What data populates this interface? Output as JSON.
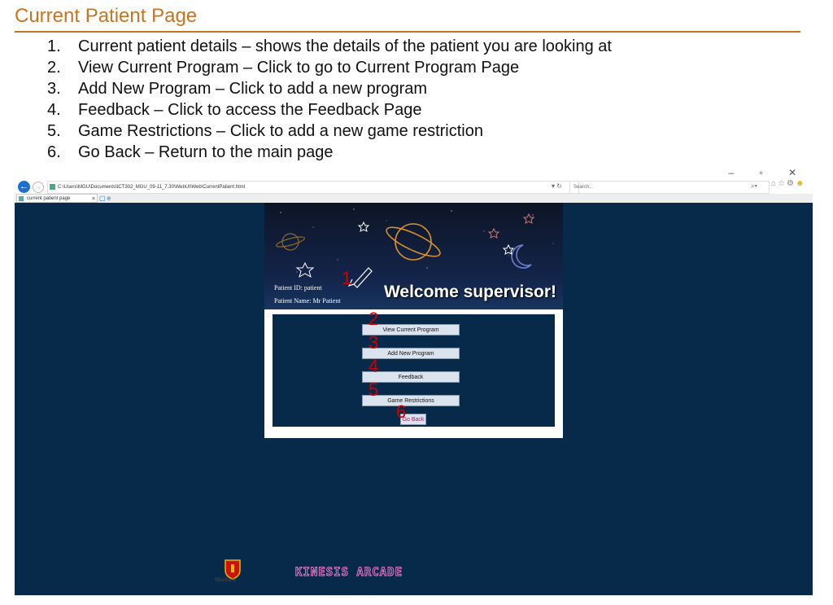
{
  "slide": {
    "title": "Current Patient Page",
    "steps": [
      {
        "num": "1.",
        "text": "Current patient details – shows the details of the patient you are looking at"
      },
      {
        "num": "2.",
        "text": "View Current Program – Click to go to Current Program Page"
      },
      {
        "num": "3.",
        "text": "Add New Program – Click to add a new program"
      },
      {
        "num": "4.",
        "text": "Feedback – Click to access the Feedback Page"
      },
      {
        "num": "5.",
        "text": "Game Restrictions – Click to add a new game restriction"
      },
      {
        "num": "6.",
        "text": "Go Back – Return to the main page"
      }
    ]
  },
  "browser": {
    "address": "C:\\Users\\MGU\\Documents\\ICT302_MGU_09-11_7.30\\WebUI\\Web\\CurrentPatient.html",
    "search_placeholder": "Search...",
    "tab_label": "current patient page",
    "window_controls": "–  ▫  ✕"
  },
  "app": {
    "patient_id": "Patient ID: patient",
    "patient_name": "Patient Name: Mr Patient",
    "welcome": "Welcome supervisor!",
    "buttons": {
      "view_program": "View Current Program",
      "add_program": "Add New Program",
      "feedback": "Feedback",
      "game_restrictions": "Game Restrictions",
      "go_back": "Go Back"
    },
    "markers": [
      "1",
      "2",
      "3",
      "4",
      "5",
      "6"
    ],
    "footer": {
      "university": "Murdoch",
      "arcade": "KINESIS ARCADE"
    }
  },
  "colors": {
    "title": "#c8741f",
    "viewport": "#072a4a",
    "marker": "#d10000"
  }
}
